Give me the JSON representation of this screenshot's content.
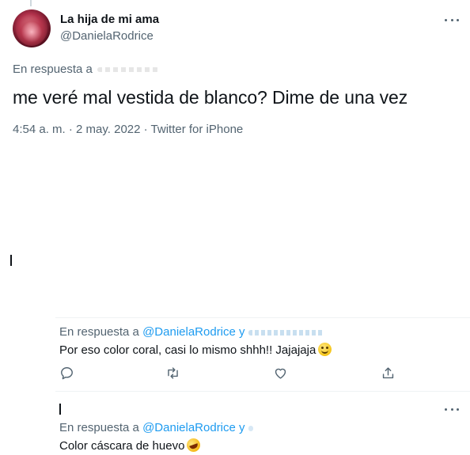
{
  "main_tweet": {
    "display_name": "La hija de mi ama",
    "handle": "@DanielaRodrice",
    "reply_to_label": "En respuesta a",
    "text": "me veré mal vestida de blanco? Dime de una vez",
    "meta": "4:54 a. m. · 2 may. 2022 · Twitter for iPhone"
  },
  "replies": [
    {
      "reply_to_label": "En respuesta a",
      "reply_to_link": "@DanielaRodrice y",
      "text": "Por eso color coral, casi lo mismo shhh!! Jajajaja",
      "emoji": "slightly-smiling-face-icon"
    },
    {
      "reply_to_label": "En respuesta a",
      "reply_to_link": "@DanielaRodrice y",
      "text": "Color cáscara de huevo",
      "emoji": "rolling-on-floor-laughing-icon"
    }
  ],
  "colors": {
    "text_primary": "#0f1419",
    "text_secondary": "#536471",
    "link": "#1d9bf0",
    "divider": "#eff3f4"
  },
  "icons": [
    "more-icon",
    "reply-icon",
    "retweet-icon",
    "like-icon",
    "share-icon"
  ]
}
